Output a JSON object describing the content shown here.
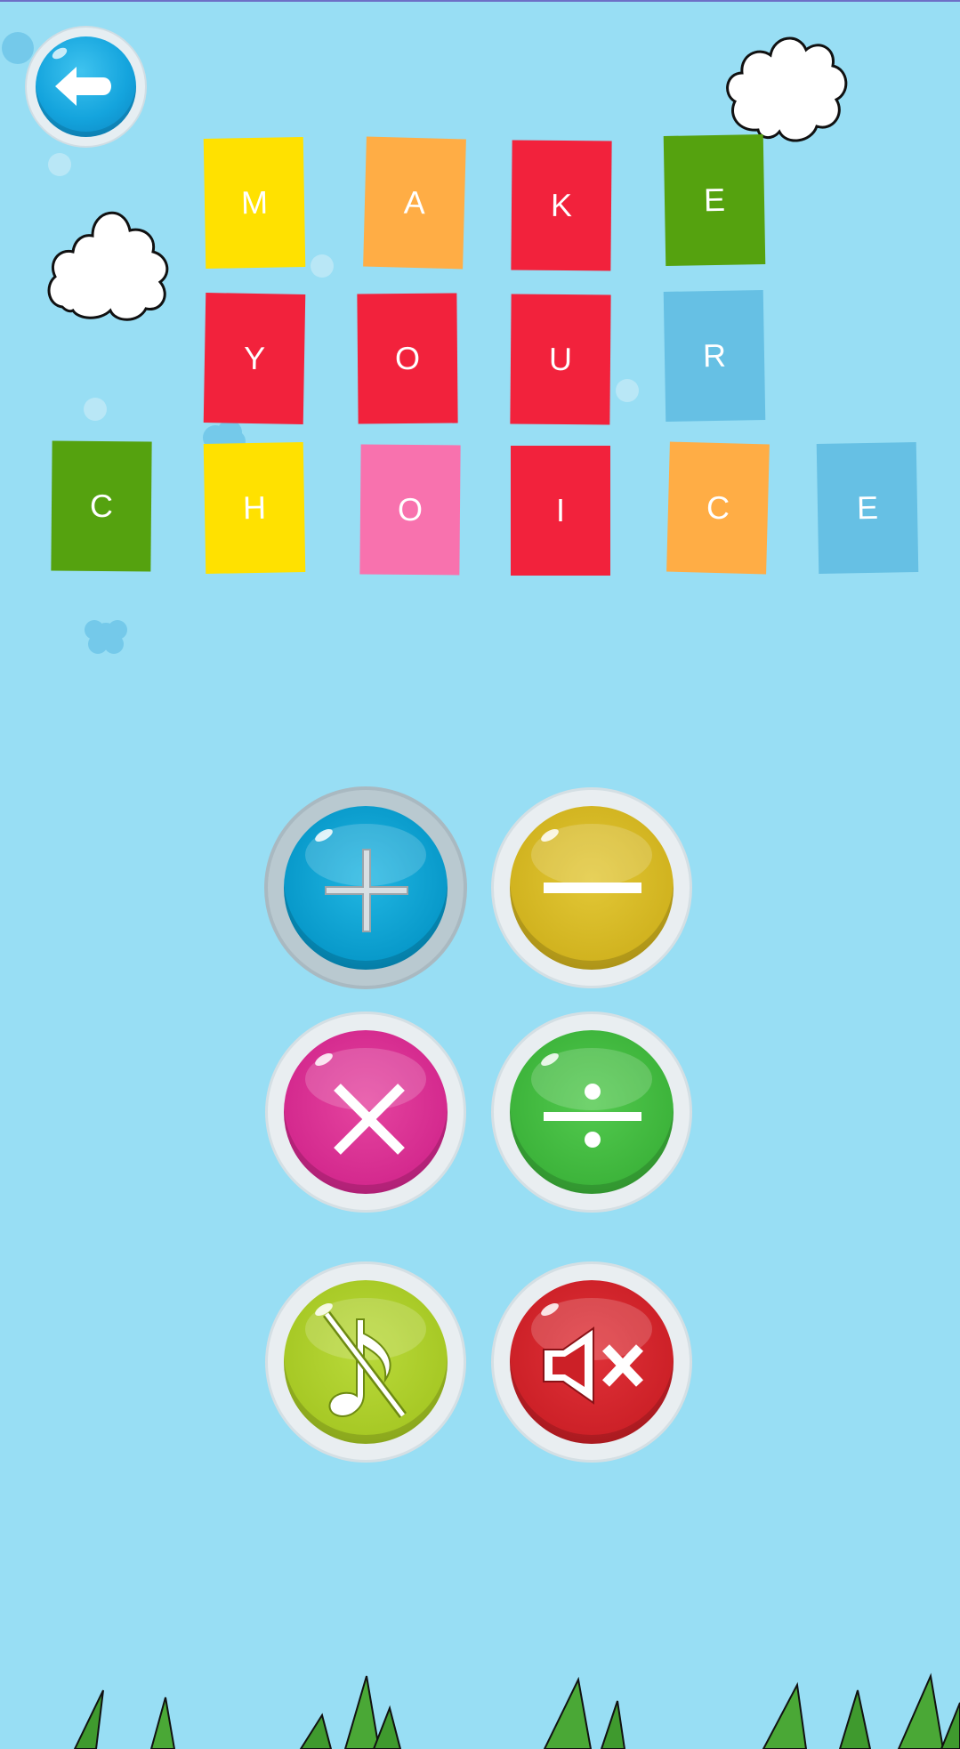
{
  "screen": {
    "background_color": "#98def4"
  },
  "back_button": {
    "icon": "back-arrow-icon",
    "color": "#14a4dd"
  },
  "title_tiles": [
    {
      "letter": "M",
      "color": "#ffe100"
    },
    {
      "letter": "A",
      "color": "#ffad45"
    },
    {
      "letter": "K",
      "color": "#f2223c"
    },
    {
      "letter": "E",
      "color": "#55a20f"
    },
    {
      "letter": "Y",
      "color": "#f2223c"
    },
    {
      "letter": "O",
      "color": "#f2223c"
    },
    {
      "letter": "U",
      "color": "#f2223c"
    },
    {
      "letter": "R",
      "color": "#66c0e4"
    },
    {
      "letter": "C",
      "color": "#55a20f"
    },
    {
      "letter": "H",
      "color": "#ffe100"
    },
    {
      "letter": "O",
      "color": "#f872ae"
    },
    {
      "letter": "I",
      "color": "#f2223c"
    },
    {
      "letter": "C",
      "color": "#ffad45"
    },
    {
      "letter": "E",
      "color": "#66c0e4"
    }
  ],
  "operation_buttons": [
    {
      "name": "addition",
      "icon": "plus-icon",
      "color": "#0798c9",
      "selected": true
    },
    {
      "name": "subtraction",
      "icon": "minus-icon",
      "color": "#d0b21e",
      "selected": false
    },
    {
      "name": "multiplication",
      "icon": "multiply-icon",
      "color": "#d3288d",
      "selected": false
    },
    {
      "name": "division",
      "icon": "divide-icon",
      "color": "#3cb33a",
      "selected": false
    }
  ],
  "sound_buttons": [
    {
      "name": "music-off",
      "icon": "music-off-icon",
      "color": "#a6c824"
    },
    {
      "name": "sound-mute",
      "icon": "speaker-mute-icon",
      "color": "#cc2027"
    }
  ]
}
